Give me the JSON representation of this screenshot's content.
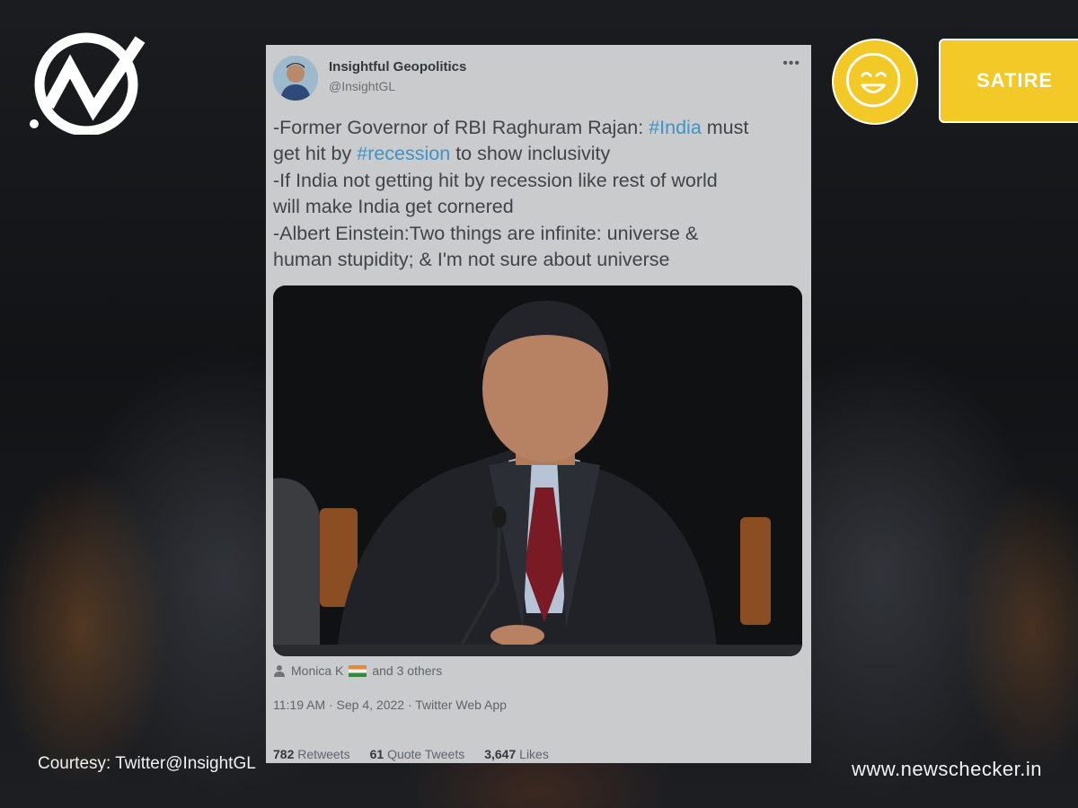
{
  "badge": {
    "label": "SATIRE",
    "emoji": "grinning-face-icon"
  },
  "tweet": {
    "author_name": "Insightful Geopolitics",
    "author_handle": "@InsightGL",
    "more": "•••",
    "lines": [
      [
        "-Former Governor of RBI Raghuram Rajan: ",
        "#India",
        " must"
      ],
      [
        "get hit by ",
        "#recession",
        " to show inclusivity"
      ],
      [
        "-If India not getting hit by recession like rest of world"
      ],
      [
        "will make India get cornered"
      ],
      [
        "-Albert Einstein:Two things are infinite: universe &"
      ],
      [
        "human stupidity; & I'm not sure about universe"
      ]
    ],
    "liked_by": {
      "name": "Monica K",
      "rest": "and 3 others"
    },
    "timestamp": "11:19 AM · Sep 4, 2022 · Twitter Web App",
    "stats": {
      "retweets_count": "782",
      "retweets_label": "Retweets",
      "quotes_count": "61",
      "quotes_label": "Quote Tweets",
      "likes_count": "3,647",
      "likes_label": "Likes"
    }
  },
  "footer": {
    "courtesy": "Courtesy: Twitter@InsightGL",
    "site": "www.newschecker.in"
  },
  "colors": {
    "badge_yellow": "#f3c928",
    "hashtag_blue": "#3f93c6",
    "card_bg": "#c9cbcd"
  }
}
